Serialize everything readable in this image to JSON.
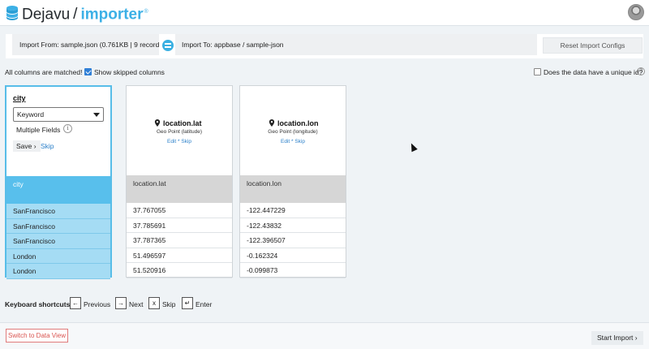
{
  "app": {
    "brand_primary": "Dejavu",
    "brand_separator": "/",
    "brand_secondary": "importer",
    "brand_mark": "®",
    "accent_color": "#3cb0e6"
  },
  "topbar": {
    "import_from_label": "Import From:",
    "import_from_value": "sample.json (0.761KB | 9 records)",
    "import_to_label": "Import To:",
    "import_to_value": "appbase / sample-json",
    "reset_button": "Reset Import Configs"
  },
  "status": {
    "matched_text": "All columns are matched!",
    "show_skipped_label": "Show skipped columns",
    "show_skipped_checked": true,
    "unique_id_label": "Does the data have a unique id?",
    "unique_id_checked": false,
    "help_glyph": "?"
  },
  "columns": [
    {
      "mode": "editing",
      "edit_title": "city",
      "type_value": "Keyword",
      "multiple_fields_label": "Multiple Fields",
      "info_glyph": "i",
      "save_label": "Save",
      "save_chevron": "›",
      "skip_label": "Skip",
      "column_name": "city",
      "rows": [
        "SanFrancisco",
        "SanFrancisco",
        "SanFrancisco",
        "London",
        "London"
      ]
    },
    {
      "mode": "mapped",
      "field_name": "location.lat",
      "field_type": "Geo Point (latitude)",
      "actions": "Edit * Skip",
      "column_name": "location.lat",
      "rows": [
        "37.767055",
        "37.785691",
        "37.787365",
        "51.496597",
        "51.520916"
      ]
    },
    {
      "mode": "mapped",
      "field_name": "location.lon",
      "field_type": "Geo Point (longitude)",
      "actions": "Edit * Skip",
      "column_name": "location.lon",
      "rows": [
        "-122.447229",
        "-122.43832",
        "-122.396507",
        "-0.162324",
        "-0.099873"
      ]
    }
  ],
  "shortcuts": {
    "title": "Keyboard shortcuts",
    "items": [
      {
        "key": "←",
        "label": "Previous"
      },
      {
        "key": "→",
        "label": "Next"
      },
      {
        "key": "x",
        "label": "Skip"
      },
      {
        "key": "↵",
        "label": "Enter"
      }
    ]
  },
  "footer": {
    "switch_button": "Switch to Data View",
    "start_button": "Start Import",
    "start_chevron": "›"
  }
}
